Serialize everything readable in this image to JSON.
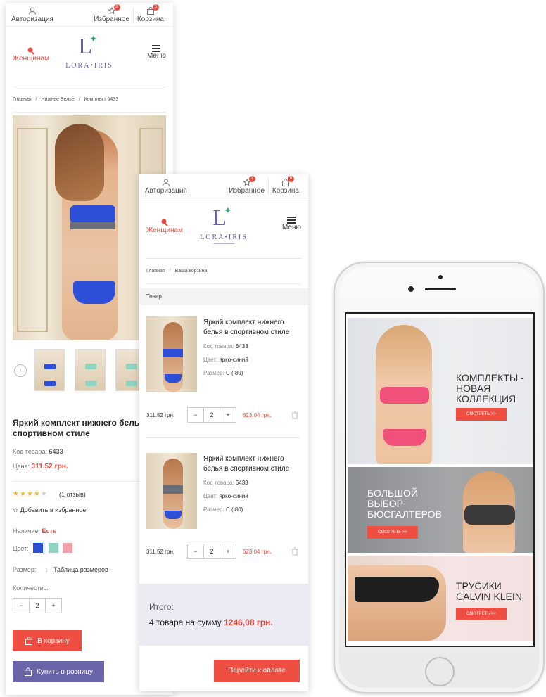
{
  "brand": {
    "logo_text": "LORA•IRIS",
    "colors": {
      "accent": "#EF4F42",
      "purple": "#6A65A8",
      "logo": "#6A5FA8"
    }
  },
  "topbar": {
    "auth": "Авторизация",
    "favorites": "Избранное",
    "favorites_count": "2",
    "cart": "Корзина",
    "cart_count": "0"
  },
  "header": {
    "women": "Женщинам",
    "menu": "Меню"
  },
  "product_page": {
    "breadcrumbs": [
      "Главная",
      "Нижнее Белье",
      "Комплект 6433"
    ],
    "title": "Яркий комплект нижнего белья в спортивном стиле",
    "code_label": "Код товара:",
    "code": "6433",
    "price_label": "Цена:",
    "price": "311.52 грн.",
    "rating": 4,
    "reviews": "(1 отзыв)",
    "favorite": "Добавить в избранное",
    "availability_label": "Наличие:",
    "availability": "Есть",
    "color_label": "Цвет:",
    "colors": [
      "#2D4FD8",
      "#8FD3C2",
      "#F2A1A8"
    ],
    "size_label": "Размер:",
    "size_table": "Таблица размеров",
    "qty_label": "Количество:",
    "qty": "2",
    "add_to_cart": "В корзину",
    "buy_retail": "Купить в розницу"
  },
  "cart_page": {
    "breadcrumbs": [
      "Главная",
      "Ваша корзина"
    ],
    "column_header": "Товар",
    "items": [
      {
        "name": "Яркий комплект нижнего белья в спортивном стиле",
        "code_label": "Код товара:",
        "code": "6433",
        "color_label": "Цвет:",
        "color": "ярко-синий",
        "size_label": "Размер:",
        "size": "С (I80)",
        "price": "311.52 грн.",
        "qty": "2",
        "total": "623.04 грн."
      },
      {
        "name": "Яркий комплект нижнего белья в спортивном стиле",
        "code_label": "Код товара:",
        "code": "6433",
        "color_label": "Цвет:",
        "color": "ярко-синий",
        "size_label": "Размер:",
        "size": "С (I80)",
        "price": "311.52 грн.",
        "qty": "2",
        "total": "623.04 грн."
      }
    ],
    "summary_label": "Итого:",
    "summary_text": "4 товара на сумму",
    "summary_amount": "1246,08 грн.",
    "checkout": "Перейти к оплате"
  },
  "phone": {
    "banners": [
      {
        "title": "КОМПЛЕКТЫ - НОВАЯ КОЛЛЕКЦИЯ",
        "button": "СМОТРЕТЬ >>"
      },
      {
        "title": "БОЛЬШОЙ ВЫБОР БЮСГАЛТЕРОВ",
        "button": "СМОТРЕТЬ >>"
      },
      {
        "title": "ТРУСИКИ CALVIN KLEIN",
        "button": "СМОТРЕТЬ >>"
      }
    ]
  }
}
